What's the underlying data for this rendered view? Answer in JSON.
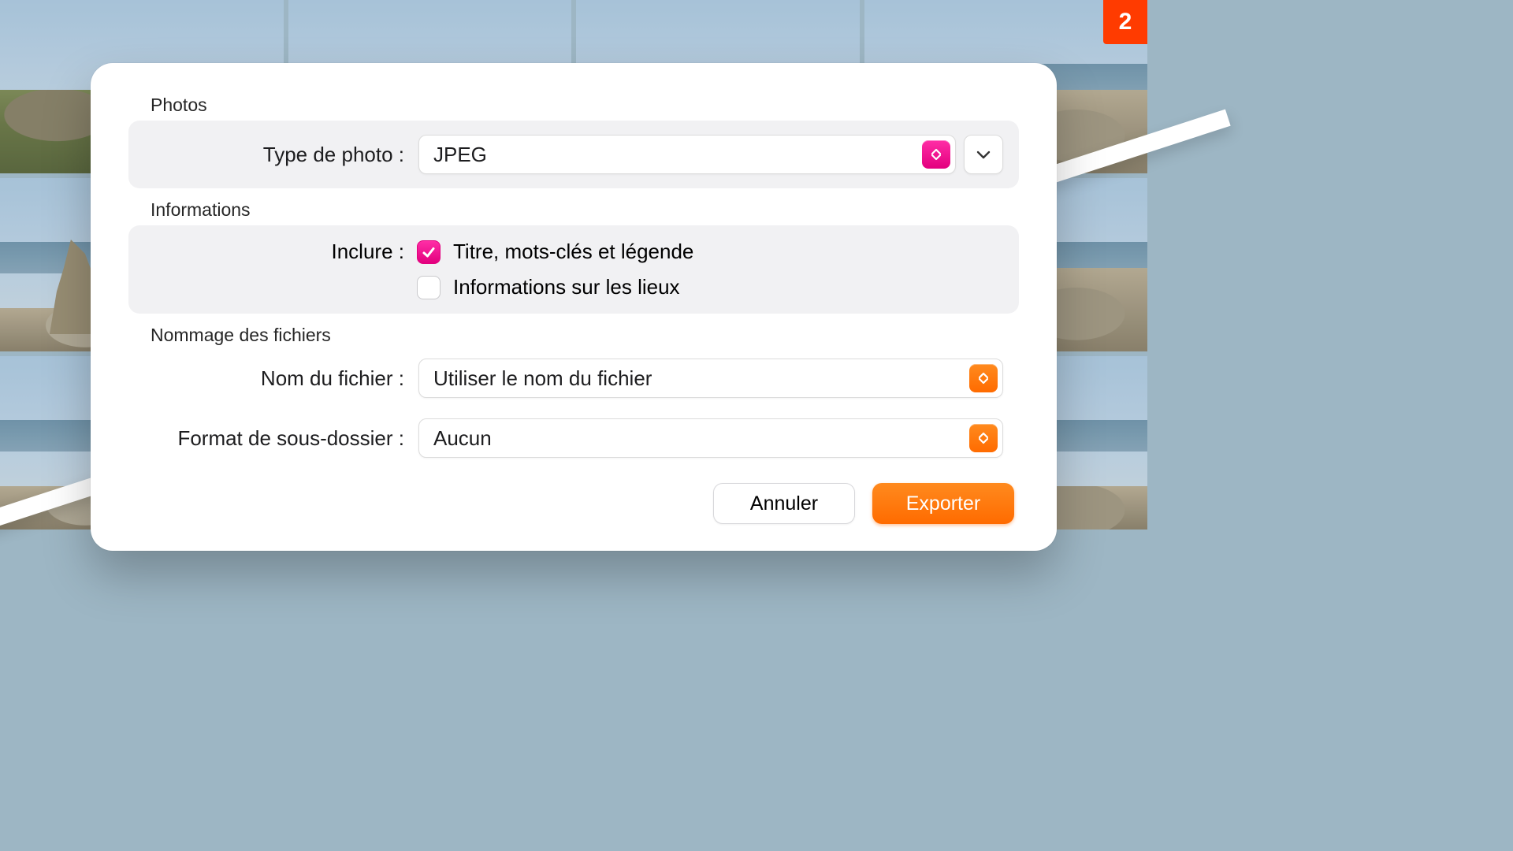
{
  "badge": "2",
  "sections": {
    "photos_title": "Photos",
    "info_title": "Informations",
    "naming_title": "Nommage des fichiers"
  },
  "photos": {
    "type_label": "Type de photo :",
    "type_value": "JPEG"
  },
  "info": {
    "include_label": "Inclure :",
    "chk1_label": "Titre, mots-clés et légende",
    "chk1_checked": true,
    "chk2_label": "Informations sur les lieux",
    "chk2_checked": false
  },
  "naming": {
    "filename_label": "Nom du fichier :",
    "filename_value": "Utiliser le nom du fichier",
    "subfolder_label": "Format de sous-dossier :",
    "subfolder_value": "Aucun"
  },
  "footer": {
    "cancel": "Annuler",
    "export": "Exporter"
  },
  "colors": {
    "accent_orange": "#ff6b00",
    "accent_magenta": "#e3007e"
  }
}
